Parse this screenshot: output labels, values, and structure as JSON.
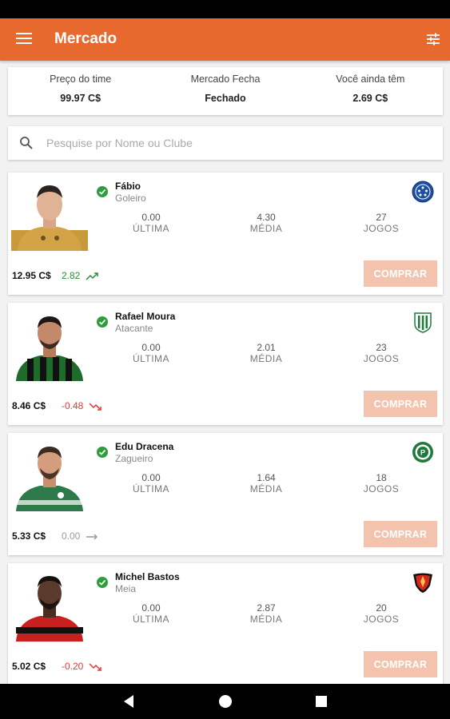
{
  "app": {
    "title": "Mercado"
  },
  "summary": [
    {
      "label": "Preço do time",
      "value": "99.97 C$"
    },
    {
      "label": "Mercado Fecha",
      "value": "Fechado"
    },
    {
      "label": "Você ainda têm",
      "value": "2.69 C$"
    }
  ],
  "search": {
    "placeholder": "Pesquise por Nome ou Clube",
    "value": ""
  },
  "stat_labels": {
    "last": "ÚLTIMA",
    "avg": "MÉDIA",
    "games": "JOGOS"
  },
  "buy_label": "COMPRAR",
  "colors": {
    "accent": "#e8692e",
    "up": "#2e8b3a",
    "down": "#e53935",
    "neutral": "#999999",
    "buy_disabled": "#f4c3ad"
  },
  "players": [
    {
      "name": "Fábio",
      "position": "Goleiro",
      "last": "0.00",
      "avg": "4.30",
      "games": "27",
      "price": "12.95 C$",
      "variation": "2.82",
      "trend": "up",
      "club_icon": "cruzeiro-badge-icon"
    },
    {
      "name": "Rafael Moura",
      "position": "Atacante",
      "last": "0.00",
      "avg": "2.01",
      "games": "23",
      "price": "8.46 C$",
      "variation": "-0.48",
      "trend": "down",
      "club_icon": "america-mg-badge-icon"
    },
    {
      "name": "Edu Dracena",
      "position": "Zagueiro",
      "last": "0.00",
      "avg": "1.64",
      "games": "18",
      "price": "5.33 C$",
      "variation": "0.00",
      "trend": "neutral",
      "club_icon": "palmeiras-badge-icon"
    },
    {
      "name": "Michel Bastos",
      "position": "Meia",
      "last": "0.00",
      "avg": "2.87",
      "games": "20",
      "price": "5.02 C$",
      "variation": "-0.20",
      "trend": "down",
      "club_icon": "sport-badge-icon"
    }
  ]
}
